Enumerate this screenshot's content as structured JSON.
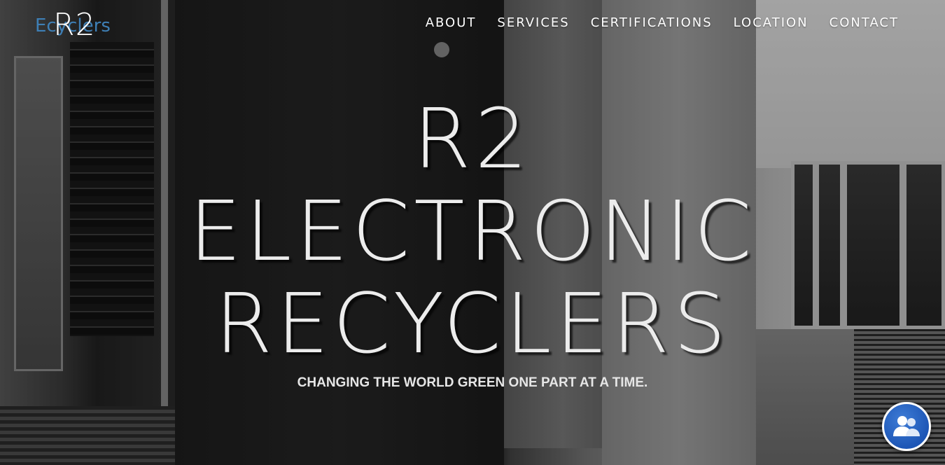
{
  "logo": {
    "mark": "R2",
    "text": "Ecyclers"
  },
  "nav": {
    "items": [
      {
        "label": "ABOUT"
      },
      {
        "label": "SERVICES"
      },
      {
        "label": "CERTIFICATIONS"
      },
      {
        "label": "LOCATION"
      },
      {
        "label": "CONTACT"
      }
    ]
  },
  "hero": {
    "title_lines": [
      "R2",
      "ELECTRONIC",
      "RECYCLERS"
    ],
    "tagline": "CHANGING THE WORLD GREEN ONE PART AT A TIME."
  },
  "chat": {
    "icon": "users-icon"
  },
  "colors": {
    "logo_accent": "#3e7fb5",
    "chat_button": "#1d56b6"
  }
}
